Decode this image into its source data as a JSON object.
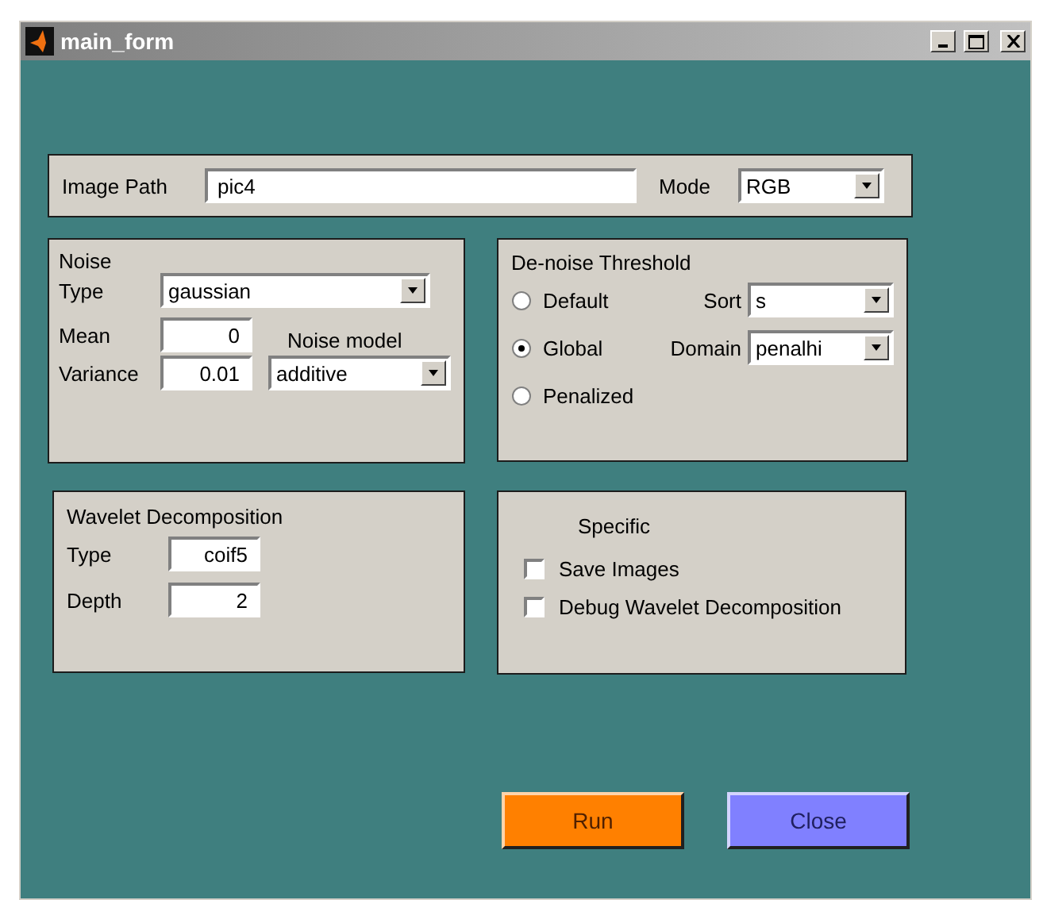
{
  "window": {
    "title": "main_form"
  },
  "image_path": {
    "label": "Image Path",
    "value": "pic4"
  },
  "mode": {
    "label": "Mode",
    "value": "RGB"
  },
  "noise": {
    "title": "Noise",
    "type_label": "Type",
    "type_value": "gaussian",
    "mean_label": "Mean",
    "mean_value": "0",
    "variance_label": "Variance",
    "variance_value": "0.01",
    "model_label": "Noise model",
    "model_value": "additive"
  },
  "threshold": {
    "title": "De-noise Threshold",
    "options": [
      {
        "label": "Default",
        "selected": false
      },
      {
        "label": "Global",
        "selected": true
      },
      {
        "label": "Penalized",
        "selected": false
      }
    ],
    "selects": [
      {
        "label": "Sort",
        "value": "s"
      },
      {
        "label": "Domain",
        "value": "penalhi"
      }
    ]
  },
  "wavelet": {
    "title": "Wavelet Decomposition",
    "type_label": "Type",
    "type_value": "coif5",
    "depth_label": "Depth",
    "depth_value": "2"
  },
  "specific": {
    "title": "Specific",
    "options": [
      {
        "label": "Save Images",
        "checked": false
      },
      {
        "label": "Debug Wavelet Decomposition",
        "checked": false
      }
    ]
  },
  "buttons": [
    {
      "label": "Run",
      "color": "#ff8000"
    },
    {
      "label": "Close",
      "color": "#8080ff"
    }
  ]
}
